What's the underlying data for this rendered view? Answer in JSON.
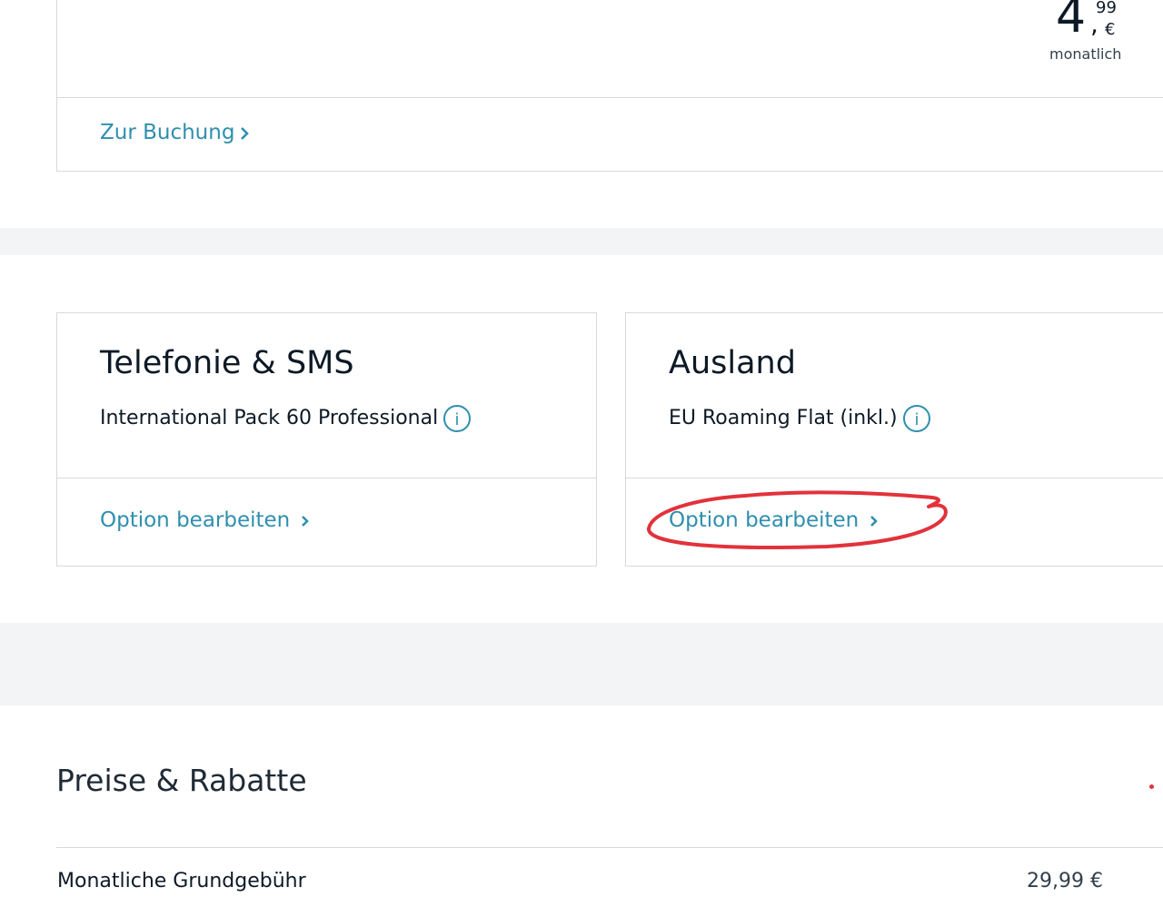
{
  "top_card": {
    "price_main": "4",
    "price_sep": ",",
    "price_cents": "99",
    "price_currency": "€",
    "price_period": "monatlich",
    "booking_link": "Zur Buchung"
  },
  "options": [
    {
      "title": "Telefonie & SMS",
      "item": "International Pack 60 Professional",
      "edit_link": "Option bearbeiten"
    },
    {
      "title": "Ausland",
      "item": "EU Roaming Flat (inkl.)",
      "edit_link": "Option bearbeiten"
    }
  ],
  "prices": {
    "heading": "Preise & Rabatte",
    "rows": [
      {
        "label": "Monatliche Grundgebühr",
        "value": "29,99 €"
      }
    ]
  },
  "colors": {
    "link": "#2f8fae",
    "annotation": "#e2323b",
    "band": "#f3f4f6"
  },
  "icons": [
    "chevron-right-icon",
    "info-icon"
  ]
}
